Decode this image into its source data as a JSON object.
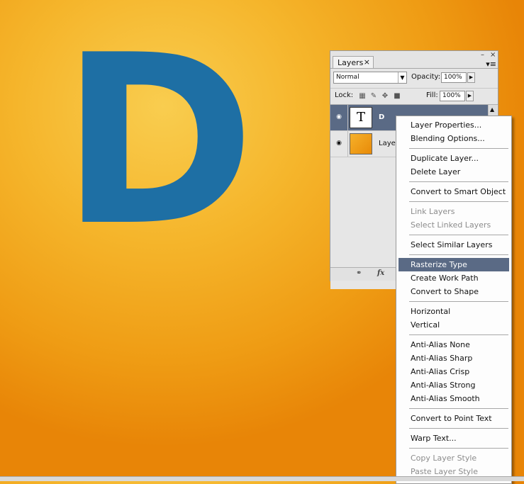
{
  "canvas": {
    "letter": "D"
  },
  "panel": {
    "tab_label": "Layers",
    "tab_close": "×",
    "minimize": "–",
    "close": "×",
    "menu": "▾≡",
    "blend_mode": "Normal",
    "opacity_label": "Opacity:",
    "opacity_value": "100%",
    "lock_label": "Lock:",
    "fill_label": "Fill:",
    "fill_value": "100%",
    "layers": [
      {
        "name": "D",
        "thumb": "T",
        "selected": true
      },
      {
        "name": "Layer",
        "thumb": "",
        "selected": false
      }
    ],
    "footer": {
      "link_icon": "⚭",
      "fx_label": "fx"
    }
  },
  "context_menu": {
    "items": [
      {
        "label": "Layer Properties...",
        "disabled": false
      },
      {
        "label": "Blending Options...",
        "disabled": false
      },
      {
        "sep": true
      },
      {
        "label": "Duplicate Layer...",
        "disabled": false
      },
      {
        "label": "Delete Layer",
        "disabled": false
      },
      {
        "sep": true
      },
      {
        "label": "Convert to Smart Object",
        "disabled": false
      },
      {
        "sep": true
      },
      {
        "label": "Link Layers",
        "disabled": true
      },
      {
        "label": "Select Linked Layers",
        "disabled": true
      },
      {
        "sep": true
      },
      {
        "label": "Select Similar Layers",
        "disabled": false
      },
      {
        "sep": true
      },
      {
        "label": "Rasterize Type",
        "disabled": false,
        "highlighted": true
      },
      {
        "label": "Create Work Path",
        "disabled": false
      },
      {
        "label": "Convert to Shape",
        "disabled": false
      },
      {
        "sep": true
      },
      {
        "label": "Horizontal",
        "disabled": false
      },
      {
        "label": "Vertical",
        "disabled": false
      },
      {
        "sep": true
      },
      {
        "label": "Anti-Alias None",
        "disabled": false
      },
      {
        "label": "Anti-Alias Sharp",
        "disabled": false
      },
      {
        "label": "Anti-Alias Crisp",
        "disabled": false
      },
      {
        "label": "Anti-Alias Strong",
        "disabled": false
      },
      {
        "label": "Anti-Alias Smooth",
        "disabled": false
      },
      {
        "sep": true
      },
      {
        "label": "Convert to Point Text",
        "disabled": false
      },
      {
        "sep": true
      },
      {
        "label": "Warp Text...",
        "disabled": false
      },
      {
        "sep": true
      },
      {
        "label": "Copy Layer Style",
        "disabled": true
      },
      {
        "label": "Paste Layer Style",
        "disabled": true
      }
    ]
  }
}
